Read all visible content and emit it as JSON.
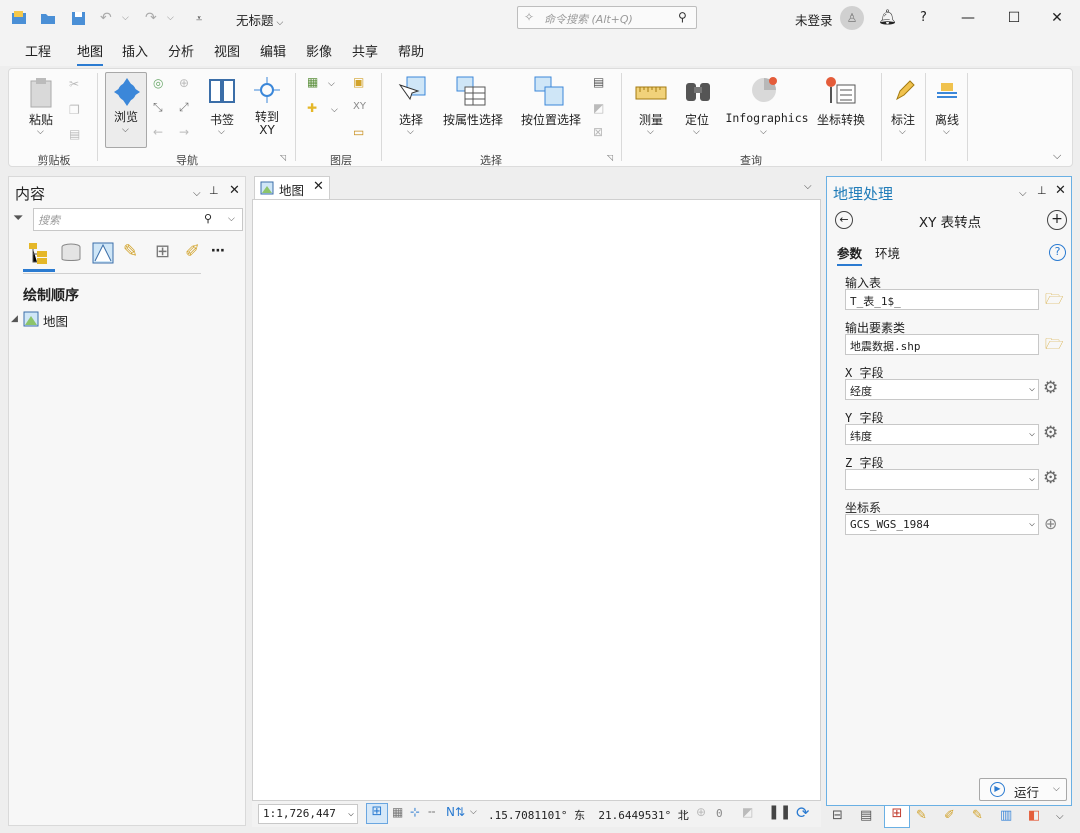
{
  "titlebar": {
    "title": "无标题",
    "search_placeholder": "命令搜索 (Alt+Q)",
    "user": "未登录",
    "help": "?"
  },
  "menu": [
    "工程",
    "地图",
    "插入",
    "分析",
    "视图",
    "编辑",
    "影像",
    "共享",
    "帮助"
  ],
  "menu_active": "地图",
  "ribbon": {
    "paste": "粘贴",
    "browse": "浏览",
    "bookmark": "书签",
    "goto_xy": "转到\nXY",
    "select": "选择",
    "select_by_attr": "按属性选择",
    "select_by_loc": "按位置选择",
    "measure": "测量",
    "locate": "定位",
    "infographics": "Infographics",
    "coord_convert": "坐标转换",
    "label": "标注",
    "offline": "离线",
    "groups": {
      "clipboard": "剪贴板",
      "navigate": "导航",
      "layer": "图层",
      "selection": "选择",
      "inquiry": "查询"
    }
  },
  "contents": {
    "title": "内容",
    "search_placeholder": "搜索",
    "draw_order": "绘制顺序",
    "map_item": "地图"
  },
  "map_tab": {
    "label": "地图"
  },
  "status": {
    "scale": "1:1,726,447",
    "coords": ".15.7081101° 东  21.6449531° 北",
    "count": "0"
  },
  "geoprocessing": {
    "title": "地理处理",
    "tool_title": "XY 表转点",
    "tab_params": "参数",
    "tab_env": "环境",
    "input_table_label": "输入表",
    "input_table_value": "T_表_1$_",
    "output_label": "输出要素类",
    "output_value": "地震数据.shp",
    "x_label": "X 字段",
    "x_value": "经度",
    "y_label": "Y 字段",
    "y_value": "纬度",
    "z_label": "Z 字段",
    "z_value": "",
    "crs_label": "坐标系",
    "crs_value": "GCS_WGS_1984",
    "run": "运行"
  },
  "colors": {
    "accent": "#2b7bd1",
    "panel_title": "#1f7bb8",
    "active_tab_border": "#2b7bd1"
  }
}
